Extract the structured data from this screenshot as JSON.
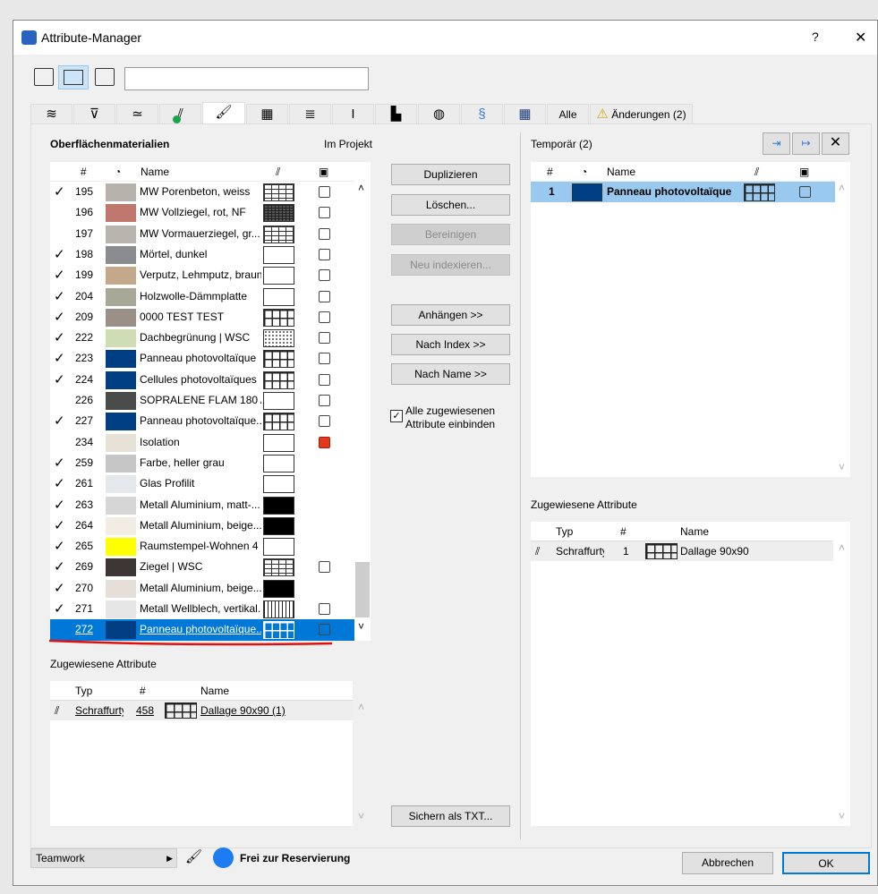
{
  "window": {
    "title": "Attribute-Manager",
    "help": "?",
    "close": "✕"
  },
  "search": {
    "value": "",
    "placeholder": ""
  },
  "tabs": {
    "all": "Alle",
    "changes": "Änderungen (2)"
  },
  "left": {
    "title": "Oberflächenmaterialien",
    "scope": "Im Projekt",
    "headers": {
      "num": "#",
      "name": "Name"
    },
    "rows": [
      {
        "check": "✓",
        "num": "195",
        "name": "MW Porenbeton, weiss",
        "color": "#b8b2ac",
        "hatch": "brick",
        "img": "normal"
      },
      {
        "check": "",
        "num": "196",
        "name": "MW Vollziegel, rot, NF",
        "color": "#c0786e",
        "hatch": "dense",
        "img": "normal"
      },
      {
        "check": "",
        "num": "197",
        "name": "MW Vormauerziegel, gr...",
        "color": "#b8b4ae",
        "hatch": "brick",
        "img": "normal"
      },
      {
        "check": "✓",
        "num": "198",
        "name": "Mörtel, dunkel",
        "color": "#8a8c90",
        "hatch": "empty",
        "img": "normal"
      },
      {
        "check": "✓",
        "num": "199",
        "name": "Verputz, Lehmputz, braun",
        "color": "#c4a88c",
        "hatch": "empty",
        "img": "normal"
      },
      {
        "check": "✓",
        "num": "204",
        "name": "Holzwolle-Dämmplatte",
        "color": "#a8a898",
        "hatch": "empty",
        "img": "normal"
      },
      {
        "check": "✓",
        "num": "209",
        "name": "0000 TEST TEST",
        "color": "#9a9088",
        "hatch": "grid",
        "img": "normal"
      },
      {
        "check": "✓",
        "num": "222",
        "name": "Dachbegrünung | WSC",
        "color": "#d0dcb4",
        "hatch": "dots",
        "img": "normal"
      },
      {
        "check": "✓",
        "num": "223",
        "name": "Panneau photovoltaïque",
        "color": "#003e84",
        "hatch": "grid",
        "img": "normal"
      },
      {
        "check": "✓",
        "num": "224",
        "name": "Cellules photovoltaïques",
        "color": "#003e84",
        "hatch": "grid",
        "img": "normal"
      },
      {
        "check": "",
        "num": "226",
        "name": "SOPRALENE FLAM 180 A...",
        "color": "#4a4c4a",
        "hatch": "empty",
        "img": "normal"
      },
      {
        "check": "✓",
        "num": "227",
        "name": "Panneau photovoltaïque...",
        "color": "#003e84",
        "hatch": "grid",
        "img": "normal"
      },
      {
        "check": "",
        "num": "234",
        "name": "Isolation",
        "color": "#e6e2d6",
        "hatch": "empty",
        "img": "red"
      },
      {
        "check": "✓",
        "num": "259",
        "name": "Farbe, heller grau",
        "color": "#c6c6c6",
        "hatch": "empty",
        "img": ""
      },
      {
        "check": "✓",
        "num": "261",
        "name": "Glas Profilit",
        "color": "#e4e8ec",
        "hatch": "empty",
        "img": ""
      },
      {
        "check": "✓",
        "num": "263",
        "name": "Metall Aluminium, matt-...",
        "color": "#d6d6d6",
        "hatch": "solid",
        "img": ""
      },
      {
        "check": "✓",
        "num": "264",
        "name": "Metall Aluminium, beige...",
        "color": "#f2ece2",
        "hatch": "solid",
        "img": ""
      },
      {
        "check": "✓",
        "num": "265",
        "name": "Raumstempel-Wohnen 4",
        "color": "#ffff00",
        "hatch": "empty",
        "img": ""
      },
      {
        "check": "✓",
        "num": "269",
        "name": "Ziegel | WSC",
        "color": "#3e3634",
        "hatch": "brick",
        "img": "normal"
      },
      {
        "check": "✓",
        "num": "270",
        "name": "Metall Aluminium, beige...",
        "color": "#e6ded8",
        "hatch": "solid",
        "img": ""
      },
      {
        "check": "✓",
        "num": "271",
        "name": "Metall Wellblech, vertikal...",
        "color": "#e6e6e6",
        "hatch": "vlines",
        "img": "normal"
      },
      {
        "check": "",
        "num": "272",
        "name": "Panneau photovoltaïque...",
        "color": "#003e84",
        "hatch": "grid",
        "img": "normal",
        "selected": true
      }
    ],
    "assigned_title": "Zugewiesene Attribute",
    "assigned_headers": {
      "type": "Typ",
      "num": "#",
      "name": "Name"
    },
    "assigned_rows": [
      {
        "type": "Schraffurty",
        "num": "458",
        "name": "Dallage 90x90 (1)"
      }
    ]
  },
  "buttons": {
    "duplicate": "Duplizieren",
    "delete": "Löschen...",
    "purge": "Bereinigen",
    "reindex": "Neu indexieren...",
    "append": "Anhängen >>",
    "by_index": "Nach Index >>",
    "by_name": "Nach Name >>",
    "include_label": "Alle zugewiesenen Attribute einbinden",
    "include_checked": true,
    "save_txt": "Sichern als TXT..."
  },
  "right": {
    "title": "Temporär (2)",
    "headers": {
      "num": "#",
      "name": "Name"
    },
    "rows": [
      {
        "num": "1",
        "name": "Panneau photovoltaïque",
        "color": "#003e84"
      }
    ],
    "assigned_title": "Zugewiesene Attribute",
    "assigned_headers": {
      "type": "Typ",
      "num": "#",
      "name": "Name"
    },
    "assigned_rows": [
      {
        "type": "Schraffurty",
        "num": "1",
        "name": "Dallage 90x90"
      }
    ]
  },
  "footer": {
    "teamwork": "Teamwork",
    "status": "Frei zur Reservierung",
    "cancel": "Abbrechen",
    "ok": "OK"
  },
  "colors": {
    "accent": "#0078d7",
    "selection_light": "#99c9ef",
    "status_dot": "#1e7cf2",
    "annotation": "#e01010"
  }
}
